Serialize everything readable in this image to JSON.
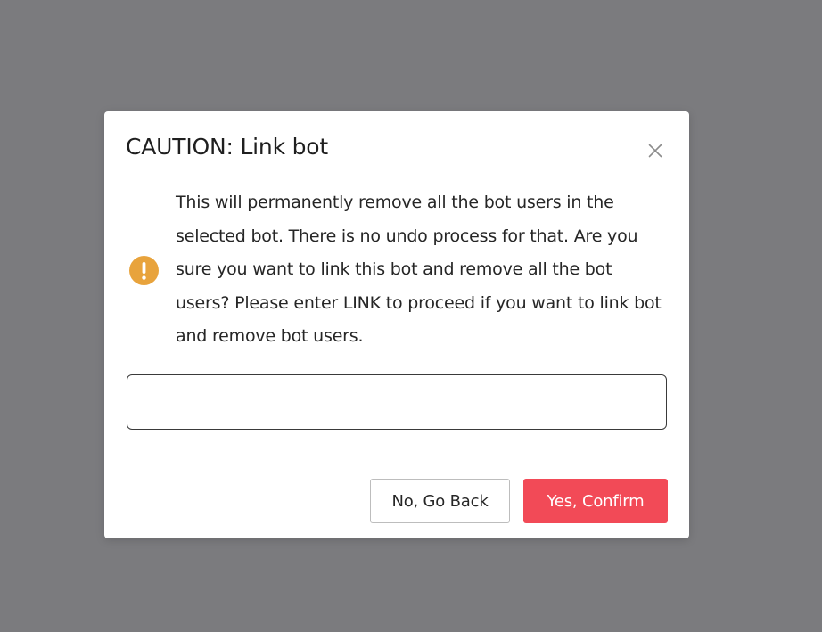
{
  "colors": {
    "backdrop": "#7b7b7e",
    "primary_danger": "#f24a57",
    "warning": "#e8a33c"
  },
  "dialog": {
    "title": "CAUTION: Link bot",
    "close_icon": "close-icon",
    "warning_icon": "exclamation-circle-icon",
    "message": "This will permanently remove all the bot users in the selected bot. There is no undo process for that. Are you sure you want to link this bot and remove all the bot users? Please enter LINK to proceed if you want to link bot and remove bot users.",
    "confirm_input": {
      "value": "",
      "placeholder": ""
    },
    "buttons": {
      "back_label": "No, Go Back",
      "confirm_label": "Yes, Confirm"
    }
  }
}
